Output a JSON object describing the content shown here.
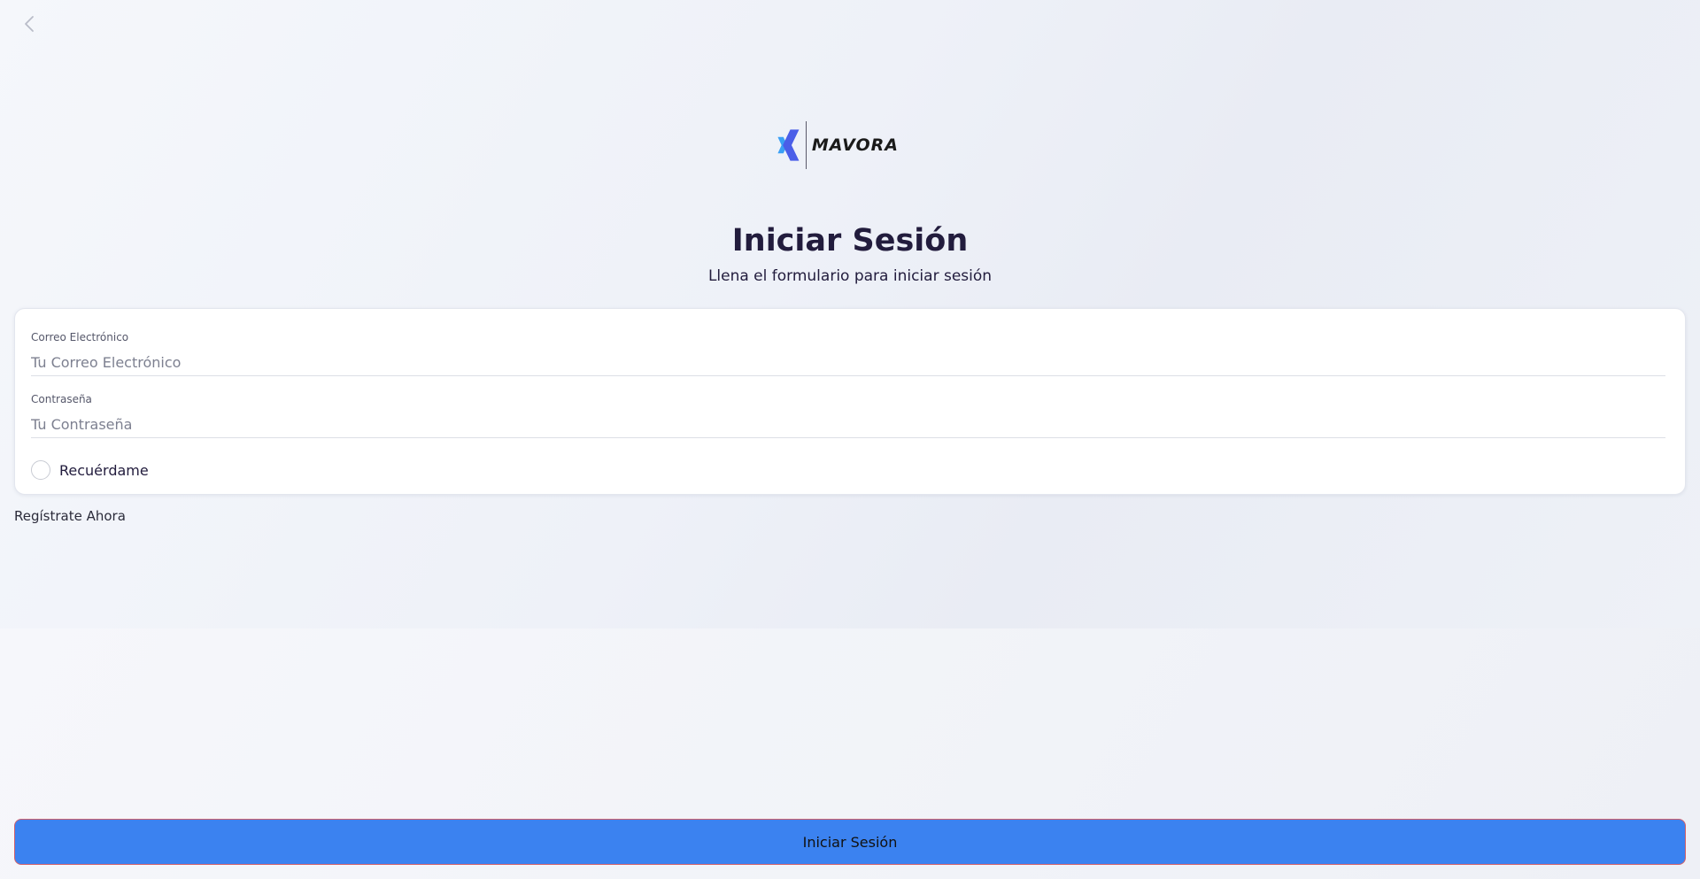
{
  "colors": {
    "primary_button": "#3b82f0",
    "button_border": "#d1606a",
    "logo_light": "#3aa0f5",
    "logo_dark": "#4a5ee8",
    "title": "#221c3d"
  },
  "header": {
    "back_icon": "chevron-left-icon"
  },
  "logo": {
    "text": "MAVORA"
  },
  "page": {
    "title": "Iniciar Sesión",
    "subtitle": "Llena el formulario para iniciar sesión"
  },
  "form": {
    "email": {
      "label": "Correo Electrónico",
      "value": "",
      "placeholder": "Tu Correo Electrónico"
    },
    "password": {
      "label": "Contraseña",
      "value": "",
      "placeholder": "Tu Contraseña"
    },
    "remember": {
      "label": "Recuérdame",
      "checked": false
    }
  },
  "links": {
    "register": "Regístrate Ahora"
  },
  "actions": {
    "submit_label": "Iniciar Sesión"
  }
}
